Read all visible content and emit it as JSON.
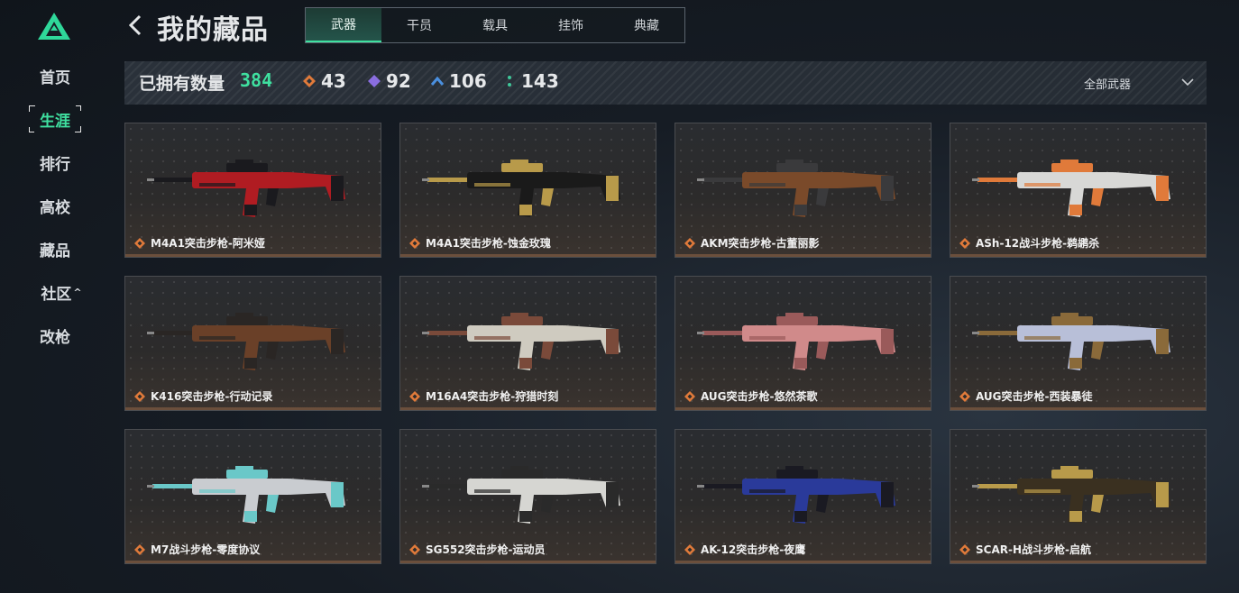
{
  "sidebar": {
    "items": [
      {
        "label": "首页",
        "active": false
      },
      {
        "label": "生涯",
        "active": true
      },
      {
        "label": "排行",
        "active": false
      },
      {
        "label": "高校",
        "active": false
      },
      {
        "label": "藏品",
        "active": false
      },
      {
        "label": "社区",
        "active": false,
        "has_caret": true
      },
      {
        "label": "改枪",
        "active": false
      }
    ],
    "caret": "^"
  },
  "header": {
    "title": "我的藏品",
    "tabs": [
      {
        "label": "武器",
        "active": true
      },
      {
        "label": "干员",
        "active": false
      },
      {
        "label": "载具",
        "active": false
      },
      {
        "label": "挂饰",
        "active": false
      },
      {
        "label": "典藏",
        "active": false
      }
    ]
  },
  "stats": {
    "owned_label": "已拥有数量",
    "owned_count": "384",
    "rarities": [
      {
        "icon": "orange-diamond-icon",
        "color": "#e07a3a",
        "count": "43"
      },
      {
        "icon": "purple-diamond-icon",
        "color": "#8a6ee0",
        "count": "92"
      },
      {
        "icon": "blue-chevron-icon",
        "color": "#4a90e0",
        "count": "106"
      },
      {
        "icon": "green-dots-icon",
        "color": "#3fc89a",
        "count": "143"
      }
    ],
    "filter_label": "全部武器"
  },
  "colors": {
    "accent": "#3fe0a0",
    "rarity_orange": "#e07a3a"
  },
  "items": [
    {
      "name": "M4A1突击步枪-阿米娅",
      "body": "#b01c22",
      "trim": "#1a1a1e"
    },
    {
      "name": "M4A1突击步枪-蚀金玫瑰",
      "body": "#1a1a1a",
      "trim": "#b89a4a"
    },
    {
      "name": "AKM突击步枪-古董丽影",
      "body": "#7a4a2a",
      "trim": "#3a3a3c"
    },
    {
      "name": "ASh-12战斗步枪-鹈鹕杀",
      "body": "#d8d8d6",
      "trim": "#e07a3a"
    },
    {
      "name": "K416突击步枪-行动记录",
      "body": "#6a4028",
      "trim": "#2a2624"
    },
    {
      "name": "M16A4突击步枪-狩猎时刻",
      "body": "#cfcbc0",
      "trim": "#7a4a3a"
    },
    {
      "name": "AUG突击步枪-悠然茶歌",
      "body": "#d08a8a",
      "trim": "#9a5a5a"
    },
    {
      "name": "AUG突击步枪-西装暴徒",
      "body": "#b8bfd8",
      "trim": "#8a6a3a"
    },
    {
      "name": "M7战斗步枪-零度协议",
      "body": "#c9ccd0",
      "trim": "#6ac8c8"
    },
    {
      "name": "SG552突击步枪-运动员",
      "body": "#d6d6d2",
      "trim": "#2a2a2a"
    },
    {
      "name": "AK-12突击步枪-夜鹰",
      "body": "#2a3a9a",
      "trim": "#1a1a22"
    },
    {
      "name": "SCAR-H战斗步枪-启航",
      "body": "#3a3020",
      "trim": "#b89a4a"
    }
  ]
}
